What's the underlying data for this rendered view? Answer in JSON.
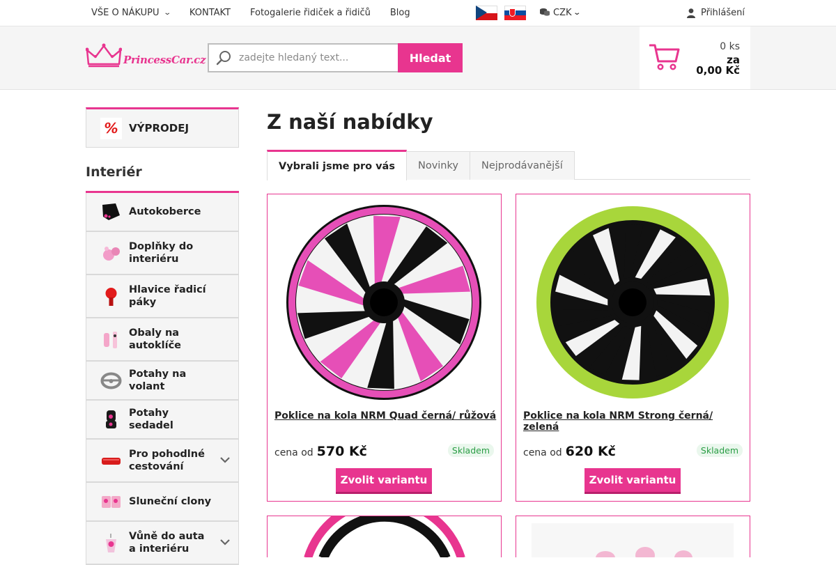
{
  "topnav": {
    "items": [
      "VŠE O NÁKUPU",
      "KONTAKT",
      "Fotogalerie řidiček a řidičů",
      "Blog"
    ],
    "currency": "CZK",
    "login": "Přihlášení"
  },
  "header": {
    "logo_text": "PrincessCar.cz",
    "search_placeholder": "zadejte hledaný text...",
    "search_button": "Hledat",
    "cart_count": "0 ks",
    "cart_za": "za",
    "cart_total": "0,00 Kč"
  },
  "sidebar": {
    "sale_label": "VÝPRODEJ",
    "section_title": "Interiér",
    "categories": [
      {
        "label": "Autokoberce",
        "expandable": false
      },
      {
        "label": "Doplňky do interiéru",
        "expandable": false
      },
      {
        "label": "Hlavice řadicí páky",
        "expandable": false
      },
      {
        "label": "Obaly na autoklíče",
        "expandable": false
      },
      {
        "label": "Potahy na volant",
        "expandable": false
      },
      {
        "label": "Potahy sedadel",
        "expandable": false
      },
      {
        "label": "Pro pohodlné cestování",
        "expandable": true
      },
      {
        "label": "Sluneční clony",
        "expandable": false
      },
      {
        "label": "Vůně do auta a interiéru",
        "expandable": true
      }
    ]
  },
  "main": {
    "title": "Z naší nabídky",
    "tabs": [
      "Vybrali jsme pro vás",
      "Novinky",
      "Nejprodávanější"
    ],
    "products": [
      {
        "name": "Poklice na kola NRM Quad černá/ růžová",
        "price_prefix": "cena od",
        "price": "570 Kč",
        "stock": "Skladem",
        "button": "Zvolit variantu",
        "accent": "#e64fb7"
      },
      {
        "name": "Poklice na kola NRM Strong černá/ zelená",
        "price_prefix": "cena od",
        "price": "620 Kč",
        "stock": "Skladem",
        "button": "Zvolit variantu",
        "accent": "#a8d63b"
      }
    ]
  },
  "colors": {
    "brand": "#e8358f",
    "stock_green": "#2a9d45"
  }
}
